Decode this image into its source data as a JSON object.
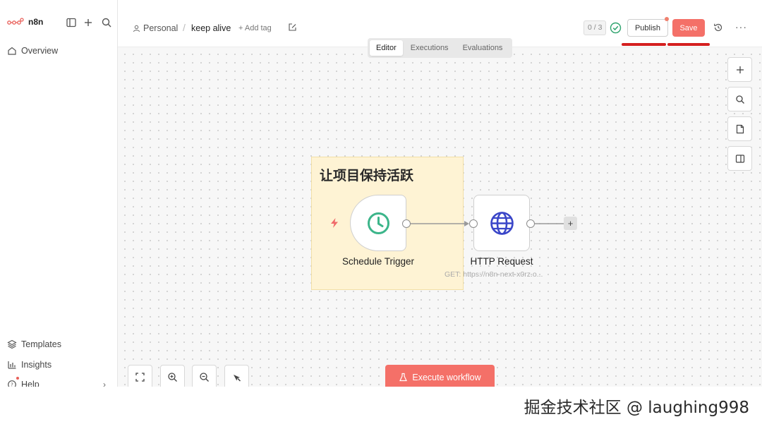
{
  "app": {
    "name": "n8n"
  },
  "sidebar": {
    "overview": "Overview",
    "templates": "Templates",
    "insights": "Insights",
    "help": "Help"
  },
  "header": {
    "project": "Personal",
    "workflow_name": "keep alive",
    "add_tag": "+ Add tag",
    "counter": "0 / 3",
    "publish_label": "Publish",
    "save_label": "Save"
  },
  "tabs": [
    {
      "label": "Editor",
      "active": true
    },
    {
      "label": "Executions",
      "active": false
    },
    {
      "label": "Evaluations",
      "active": false
    }
  ],
  "canvas": {
    "sticky_note": "让项目保持活跃",
    "nodes": [
      {
        "label": "Schedule Trigger"
      },
      {
        "label": "HTTP Request",
        "subtitle": "GET: https://n8n-next-x0rz.o..."
      }
    ],
    "execute_label": "Execute workflow"
  },
  "watermark": "掘金技术社区 @ laughing998",
  "colors": {
    "accent": "#f47068",
    "trigger_icon": "#3cb58a",
    "http_icon": "#3a46c8",
    "sticky_bg": "#fef3d4",
    "annotation": "#d41f1f"
  }
}
